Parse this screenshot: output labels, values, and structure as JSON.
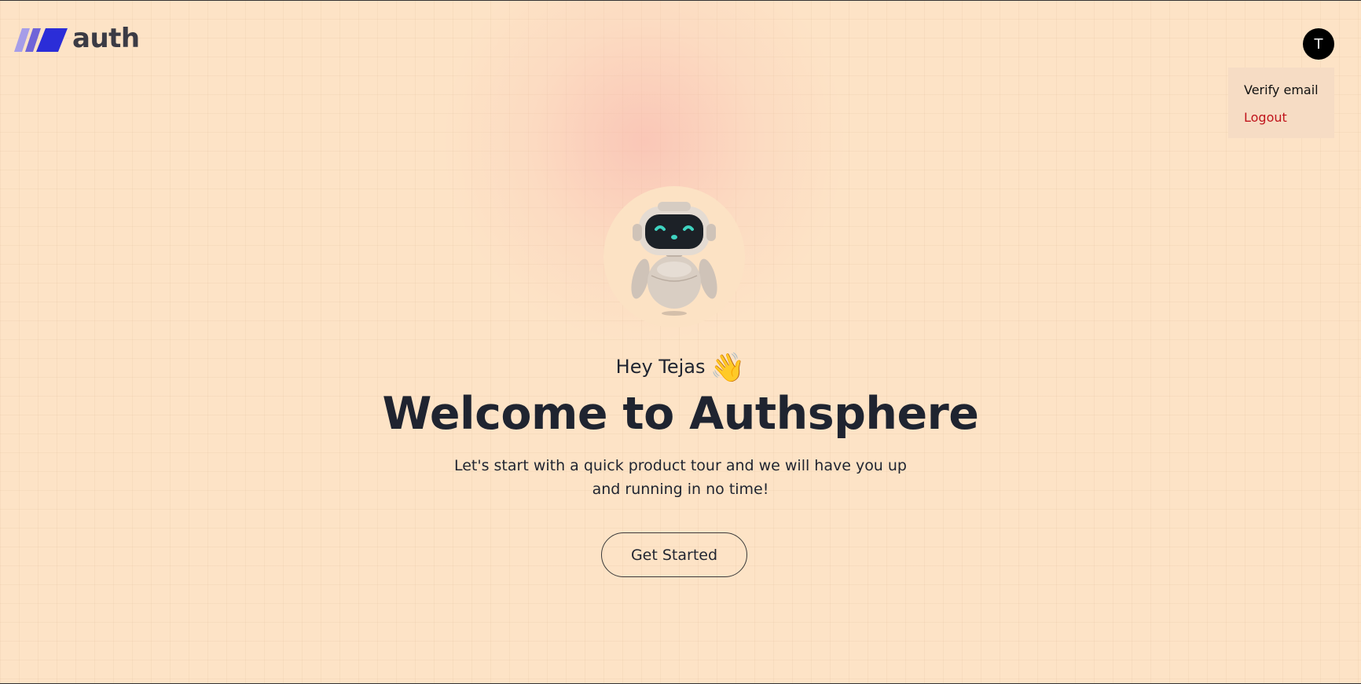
{
  "brand": {
    "name": "auth"
  },
  "user": {
    "initial": "T"
  },
  "menu": {
    "verify_email": "Verify email",
    "logout": "Logout"
  },
  "hero": {
    "greeting": "Hey Tejas",
    "title": "Welcome to Authsphere",
    "subtitle": "Let's start with a quick product tour and we will have you up and running in no time!",
    "cta": "Get Started"
  },
  "colors": {
    "background": "#fde3c6",
    "brand_stripes": [
      "#9b8fe6",
      "#6b5fd6",
      "#2b2dd8"
    ],
    "logout": "#c0141c",
    "avatar": "#000000"
  },
  "icons": {
    "logo": "slash-stripes-icon",
    "robot": "robot-icon",
    "wave": "waving-hand-icon"
  }
}
